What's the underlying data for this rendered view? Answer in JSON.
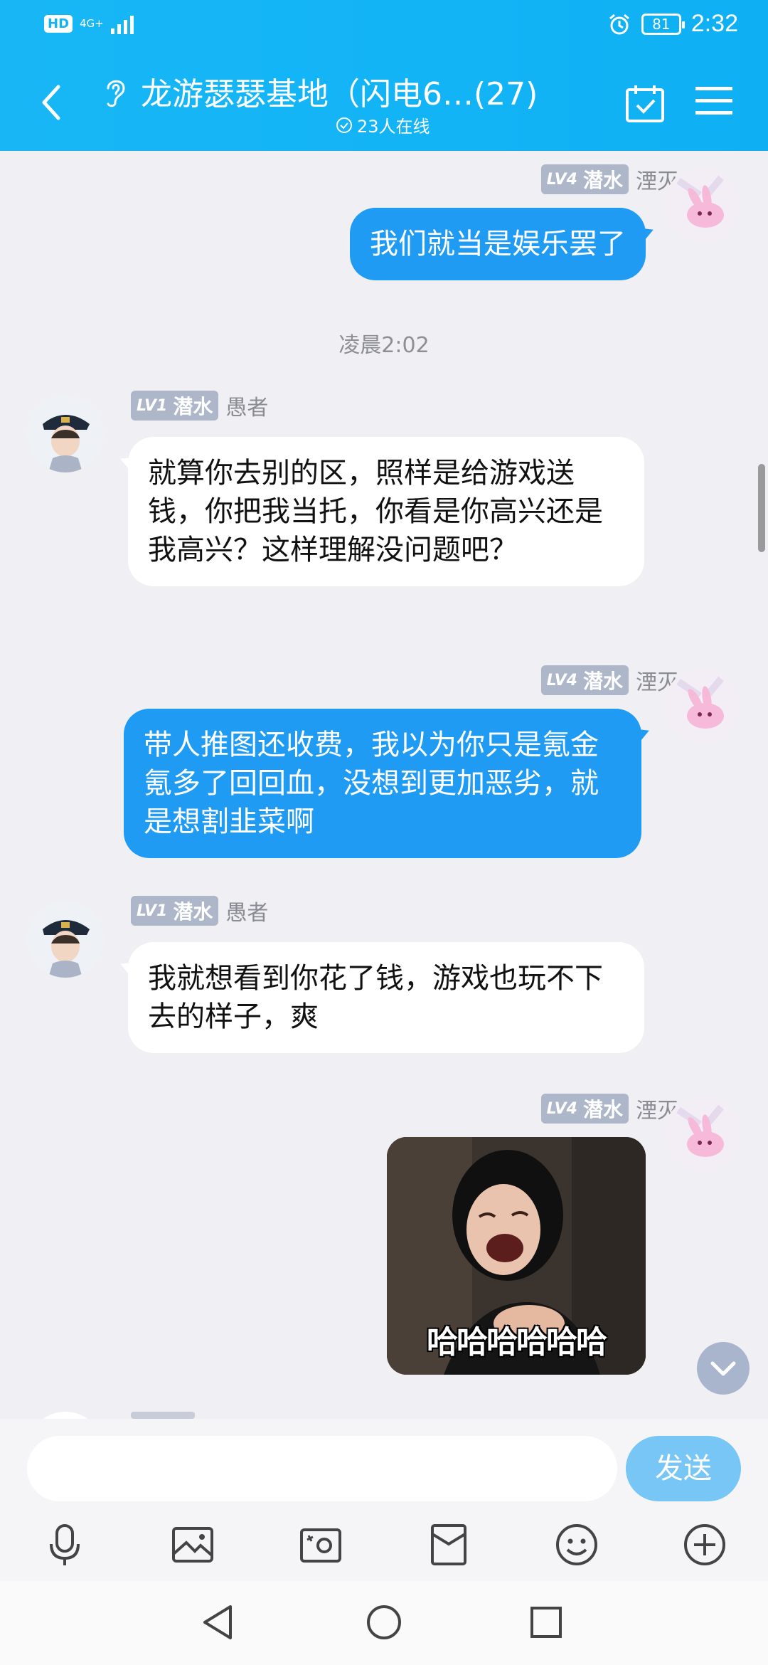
{
  "status_bar": {
    "hd": "HD",
    "network": "4G+",
    "battery": "81",
    "time": "2:32"
  },
  "header": {
    "title": "龙游瑟瑟基地（闪电6…(27)",
    "online": "23人在线"
  },
  "messages": [
    {
      "side": "me",
      "level": "LV4",
      "rank": "潜水",
      "name": "湮灭",
      "text": "我们就当是娱乐罢了"
    },
    {
      "timestamp": "凌晨2:02"
    },
    {
      "side": "other",
      "level": "LV1",
      "rank": "潜水",
      "name": "愚者",
      "text": "就算你去别的区，照样是给游戏送钱，你把我当托，你看是你高兴还是我高兴？这样理解没问题吧？"
    },
    {
      "side": "me",
      "level": "LV4",
      "rank": "潜水",
      "name": "湮灭",
      "text": "带人推图还收费，我以为你只是氪金氪多了回回血，没想到更加恶劣，就是想割韭菜啊"
    },
    {
      "side": "other",
      "level": "LV1",
      "rank": "潜水",
      "name": "愚者",
      "text": "我就想看到你花了钱，游戏也玩不下去的样子，爽"
    },
    {
      "side": "me",
      "level": "LV4",
      "rank": "潜水",
      "name": "湮灭",
      "sticker_text": "哈哈哈哈哈哈"
    }
  ],
  "input": {
    "placeholder": "",
    "send_label": "发送"
  },
  "toolbar": {
    "icons": [
      "microphone-icon",
      "image-icon",
      "camera-icon",
      "red-packet-icon",
      "emoji-icon",
      "plus-icon"
    ]
  },
  "colors": {
    "header": "#12b4f6",
    "my_bubble": "#1f9bf3",
    "send_button": "#78c6f5"
  }
}
